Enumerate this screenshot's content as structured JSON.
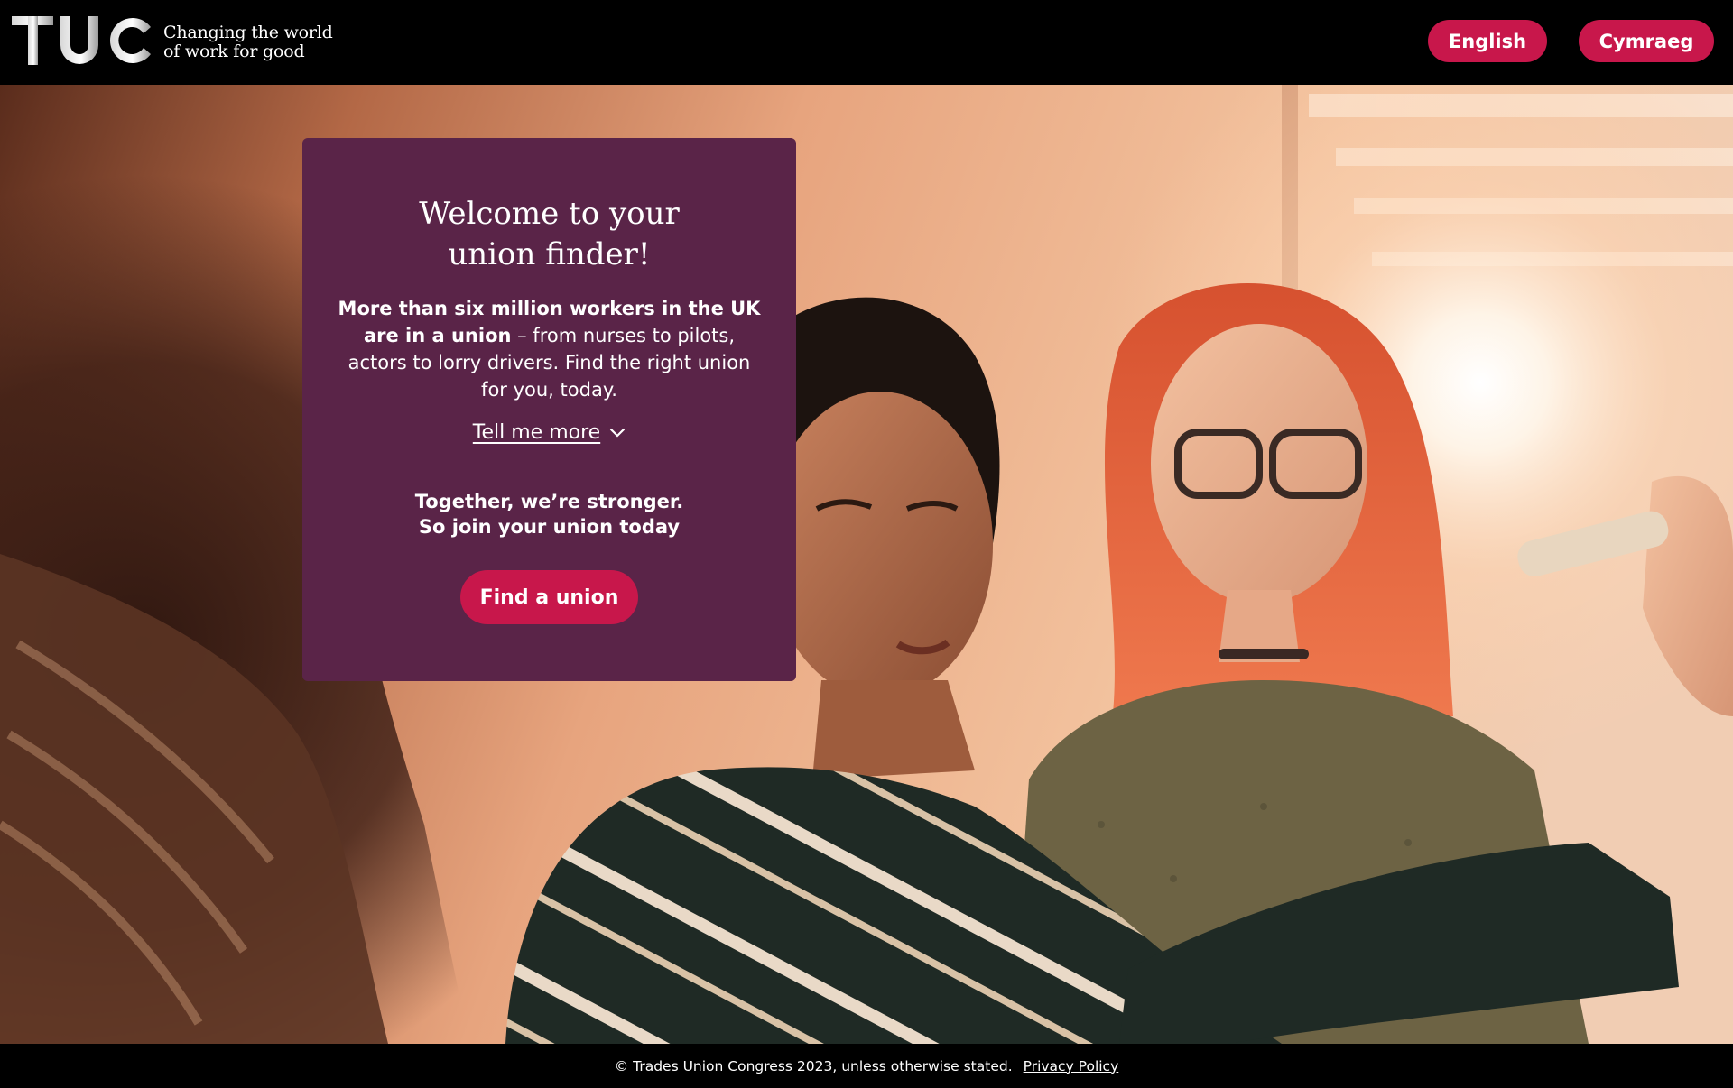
{
  "header": {
    "logo_text": "TUC",
    "tagline_line1": "Changing the world",
    "tagline_line2": "of work for good",
    "languages": [
      {
        "label": "English"
      },
      {
        "label": "Cymraeg"
      }
    ],
    "button_color": "#c8174b"
  },
  "card": {
    "title_line1": "Welcome to your",
    "title_line2": "union finder!",
    "intro_bold": "More than six million workers in the UK are in a union",
    "intro_rest": " – from nurses to pilots, actors to lorry drivers. Find the right union for you, today.",
    "tell_more": "Tell me more",
    "together_line1": "Together, we’re stronger.",
    "together_line2": "So join your union today",
    "cta": "Find a union",
    "background_color": "#5a2448"
  },
  "footer": {
    "copyright": "© Trades Union Congress 2023, unless otherwise stated.",
    "privacy": "Privacy Policy"
  },
  "icons": [
    "tuc-logo-icon",
    "chevron-down-icon"
  ]
}
